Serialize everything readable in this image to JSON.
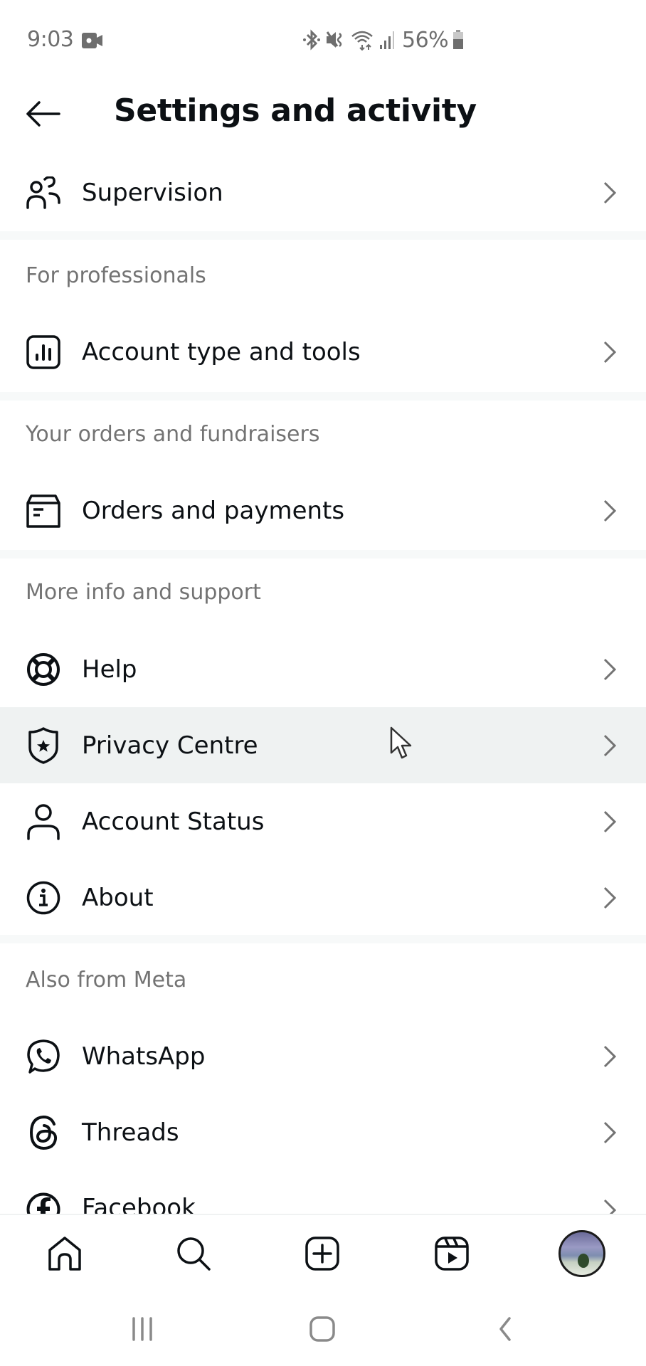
{
  "status_bar": {
    "time": "9:03",
    "battery_percent": "56%",
    "icons": [
      "screen-record-icon",
      "bluetooth-icon",
      "vibrate-mute-icon",
      "wifi-icon",
      "signal-icon",
      "battery-icon"
    ]
  },
  "header": {
    "back_icon": "arrow-left-icon",
    "title": "Settings and activity"
  },
  "rows": {
    "supervision": {
      "label": "Supervision",
      "icon": "supervision-people-icon"
    },
    "account_type": {
      "label": "Account type and tools",
      "icon": "bar-chart-icon"
    },
    "orders": {
      "label": "Orders and payments",
      "icon": "orders-box-icon"
    },
    "help": {
      "label": "Help",
      "icon": "lifebuoy-icon"
    },
    "privacy": {
      "label": "Privacy Centre",
      "icon": "shield-star-icon"
    },
    "account_status": {
      "label": "Account Status",
      "icon": "person-icon"
    },
    "about": {
      "label": "About",
      "icon": "info-icon"
    },
    "whatsapp": {
      "label": "WhatsApp",
      "icon": "whatsapp-icon"
    },
    "threads": {
      "label": "Threads",
      "icon": "threads-icon"
    },
    "facebook": {
      "label": "Facebook",
      "icon": "facebook-icon"
    }
  },
  "sections": {
    "professionals": "For professionals",
    "orders": "Your orders and fundraisers",
    "support": "More info and support",
    "meta": "Also from Meta"
  },
  "highlighted_row": "Privacy Centre",
  "bottom_nav": [
    "home-icon",
    "search-icon",
    "create-post-icon",
    "reels-icon",
    "profile-avatar"
  ],
  "system_nav": [
    "recent-apps-icon",
    "home-button-icon",
    "back-icon"
  ],
  "colors": {
    "text": "#0c1014",
    "secondary_text": "#737373",
    "divider": "#f7f9f9",
    "highlight": "#eff2f2"
  }
}
